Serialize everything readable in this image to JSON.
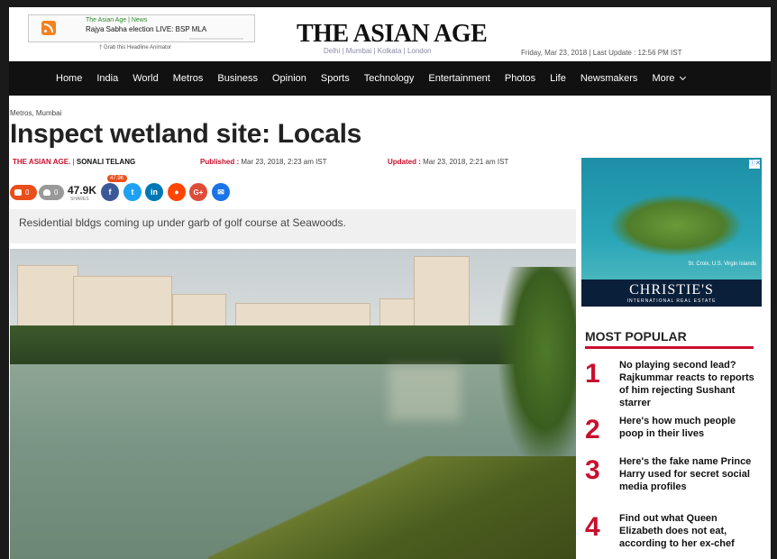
{
  "header": {
    "rss_source": "The Asian Age | News",
    "rss_headline": "Rajya Sabha election LIVE: BSP MLA",
    "grab_text": "† Grab this Headline Animator",
    "logo": "THE ASIAN AGE",
    "cities": "Delhi | Mumbai | Kolkata | London",
    "dateline": "Friday, Mar 23, 2018 | Last Update : 12:56 PM IST"
  },
  "nav": {
    "items": [
      "Home",
      "India",
      "World",
      "Metros",
      "Business",
      "Opinion",
      "Sports",
      "Technology",
      "Entertainment",
      "Photos",
      "Life",
      "Newsmakers"
    ],
    "more": "More"
  },
  "article": {
    "breadcrumb": "Metros, Mumbai",
    "title": "Inspect wetland site: Locals",
    "source": "THE ASIAN AGE.",
    "author": "SONALI TELANG",
    "published_label": "Published :",
    "published": "Mar 23, 2018, 2:23 am IST",
    "updated_label": "Updated :",
    "updated": "Mar 23, 2018, 2:21 am IST",
    "summary": "Residential bldgs coming up under garb of golf course at Seawoods."
  },
  "social": {
    "comments": "0",
    "likes": "0",
    "shares": "47.9K",
    "shares_label": "SHARES",
    "fb_badge": "47.9K"
  },
  "ad": {
    "caption": "St. Croix, U.S. Virgin Islands",
    "brand": "CHRISTIE'S",
    "subbrand": "INTERNATIONAL REAL ESTATE"
  },
  "most_popular": {
    "title": "MOST POPULAR",
    "items": [
      {
        "num": "1",
        "text": "No playing second lead? Rajkummar reacts to reports of him rejecting Sushant starrer"
      },
      {
        "num": "2",
        "text": "Here's how much people poop in their lives"
      },
      {
        "num": "3",
        "text": "Here's the fake name Prince Harry used for secret social media profiles"
      },
      {
        "num": "4",
        "text": "Find out what Queen Elizabeth does not eat, according to her ex-chef"
      }
    ]
  }
}
